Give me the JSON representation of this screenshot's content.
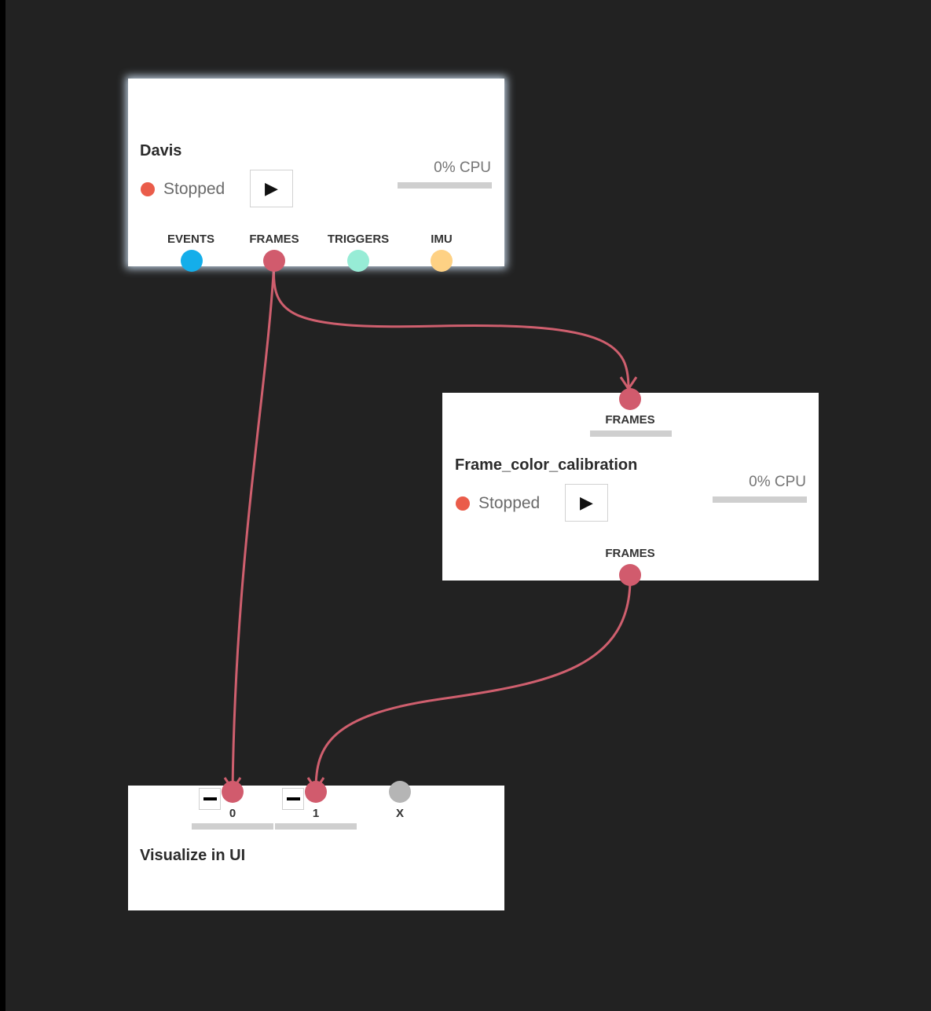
{
  "colors": {
    "background": "#222222",
    "wire": "#cf5f6e",
    "port_frames": "#d15b6d",
    "port_events": "#14aeea",
    "port_triggers": "#97ecd6",
    "port_imu": "#fed184",
    "port_empty": "#b5b5b5",
    "status_stopped": "#ea5c4a",
    "cpu_bar": "#cfcfcf"
  },
  "modules": {
    "davis": {
      "title": "Davis",
      "status": "Stopped",
      "play_icon": "play-icon",
      "cpu": "0% CPU",
      "outputs": [
        "EVENTS",
        "FRAMES",
        "TRIGGERS",
        "IMU"
      ]
    },
    "frame_color_calibration": {
      "title": "Frame_color_calibration",
      "status": "Stopped",
      "play_icon": "play-icon",
      "cpu": "0% CPU",
      "input": "FRAMES",
      "output": "FRAMES"
    },
    "visualize": {
      "title": "Visualize in UI",
      "inputs": [
        "0",
        "1",
        "X"
      ],
      "remove_icon": "minus-icon"
    }
  },
  "connections": [
    {
      "from": "Davis.FRAMES",
      "to": "Frame_color_calibration.FRAMES"
    },
    {
      "from": "Davis.FRAMES",
      "to": "Visualize in UI.0"
    },
    {
      "from": "Frame_color_calibration.FRAMES",
      "to": "Visualize in UI.1"
    }
  ]
}
